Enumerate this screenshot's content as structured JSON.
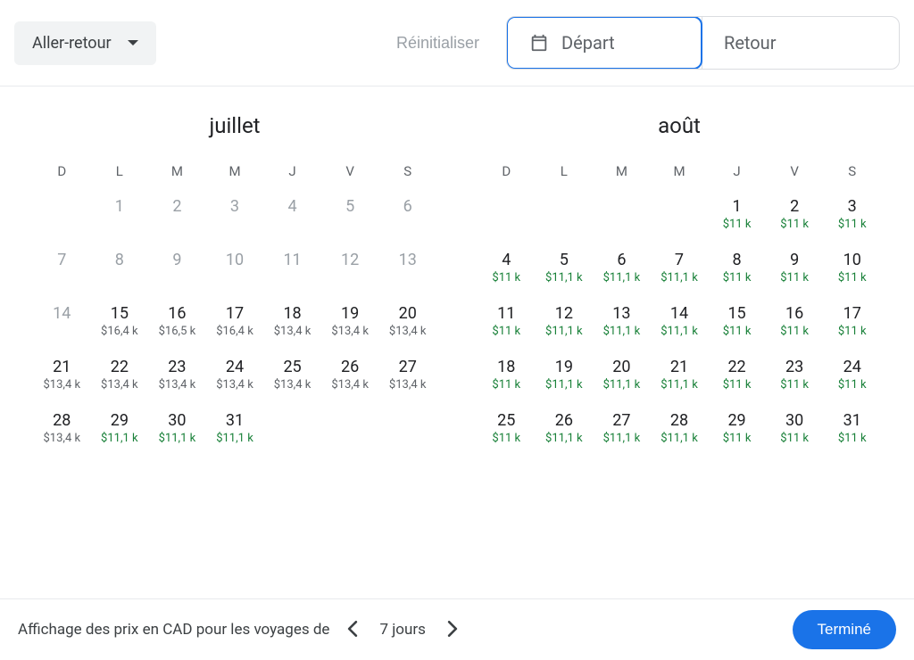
{
  "trip_type": {
    "label": "Aller-retour"
  },
  "reset_label": "Réinitialiser",
  "depart": {
    "label": "Départ"
  },
  "return": {
    "label": "Retour"
  },
  "dow": [
    "D",
    "L",
    "M",
    "M",
    "J",
    "V",
    "S"
  ],
  "months": [
    {
      "title": "juillet",
      "weeks": [
        [
          null,
          {
            "n": "1",
            "d": true
          },
          {
            "n": "2",
            "d": true
          },
          {
            "n": "3",
            "d": true
          },
          {
            "n": "4",
            "d": true
          },
          {
            "n": "5",
            "d": true
          },
          {
            "n": "6",
            "d": true
          }
        ],
        [
          {
            "n": "7",
            "d": true
          },
          {
            "n": "8",
            "d": true
          },
          {
            "n": "9",
            "d": true
          },
          {
            "n": "10",
            "d": true
          },
          {
            "n": "11",
            "d": true
          },
          {
            "n": "12",
            "d": true
          },
          {
            "n": "13",
            "d": true
          }
        ],
        [
          {
            "n": "14",
            "d": true
          },
          {
            "n": "15",
            "p": "$16,4 k"
          },
          {
            "n": "16",
            "p": "$16,5 k"
          },
          {
            "n": "17",
            "p": "$16,4 k"
          },
          {
            "n": "18",
            "p": "$13,4 k"
          },
          {
            "n": "19",
            "p": "$13,4 k"
          },
          {
            "n": "20",
            "p": "$13,4 k"
          }
        ],
        [
          {
            "n": "21",
            "p": "$13,4 k"
          },
          {
            "n": "22",
            "p": "$13,4 k"
          },
          {
            "n": "23",
            "p": "$13,4 k"
          },
          {
            "n": "24",
            "p": "$13,4 k"
          },
          {
            "n": "25",
            "p": "$13,4 k"
          },
          {
            "n": "26",
            "p": "$13,4 k"
          },
          {
            "n": "27",
            "p": "$13,4 k"
          }
        ],
        [
          {
            "n": "28",
            "p": "$13,4 k"
          },
          {
            "n": "29",
            "p": "$11,1 k",
            "g": true
          },
          {
            "n": "30",
            "p": "$11,1 k",
            "g": true
          },
          {
            "n": "31",
            "p": "$11,1 k",
            "g": true
          },
          null,
          null,
          null
        ]
      ]
    },
    {
      "title": "août",
      "weeks": [
        [
          null,
          null,
          null,
          null,
          {
            "n": "1",
            "p": "$11 k",
            "g": true
          },
          {
            "n": "2",
            "p": "$11 k",
            "g": true
          },
          {
            "n": "3",
            "p": "$11 k",
            "g": true
          }
        ],
        [
          {
            "n": "4",
            "p": "$11 k",
            "g": true
          },
          {
            "n": "5",
            "p": "$11,1 k",
            "g": true
          },
          {
            "n": "6",
            "p": "$11,1 k",
            "g": true
          },
          {
            "n": "7",
            "p": "$11,1 k",
            "g": true
          },
          {
            "n": "8",
            "p": "$11 k",
            "g": true
          },
          {
            "n": "9",
            "p": "$11 k",
            "g": true
          },
          {
            "n": "10",
            "p": "$11 k",
            "g": true
          }
        ],
        [
          {
            "n": "11",
            "p": "$11 k",
            "g": true
          },
          {
            "n": "12",
            "p": "$11,1 k",
            "g": true
          },
          {
            "n": "13",
            "p": "$11,1 k",
            "g": true
          },
          {
            "n": "14",
            "p": "$11,1 k",
            "g": true
          },
          {
            "n": "15",
            "p": "$11 k",
            "g": true
          },
          {
            "n": "16",
            "p": "$11 k",
            "g": true
          },
          {
            "n": "17",
            "p": "$11 k",
            "g": true
          }
        ],
        [
          {
            "n": "18",
            "p": "$11 k",
            "g": true
          },
          {
            "n": "19",
            "p": "$11,1 k",
            "g": true
          },
          {
            "n": "20",
            "p": "$11,1 k",
            "g": true
          },
          {
            "n": "21",
            "p": "$11,1 k",
            "g": true
          },
          {
            "n": "22",
            "p": "$11 k",
            "g": true
          },
          {
            "n": "23",
            "p": "$11 k",
            "g": true
          },
          {
            "n": "24",
            "p": "$11 k",
            "g": true
          }
        ],
        [
          {
            "n": "25",
            "p": "$11 k",
            "g": true
          },
          {
            "n": "26",
            "p": "$11,1 k",
            "g": true
          },
          {
            "n": "27",
            "p": "$11,1 k",
            "g": true
          },
          {
            "n": "28",
            "p": "$11,1 k",
            "g": true
          },
          {
            "n": "29",
            "p": "$11 k",
            "g": true
          },
          {
            "n": "30",
            "p": "$11 k",
            "g": true
          },
          {
            "n": "31",
            "p": "$11 k",
            "g": true
          }
        ]
      ]
    }
  ],
  "footer": {
    "text": "Affichage des prix en CAD pour les voyages de",
    "duration": "7 jours",
    "done": "Terminé"
  }
}
